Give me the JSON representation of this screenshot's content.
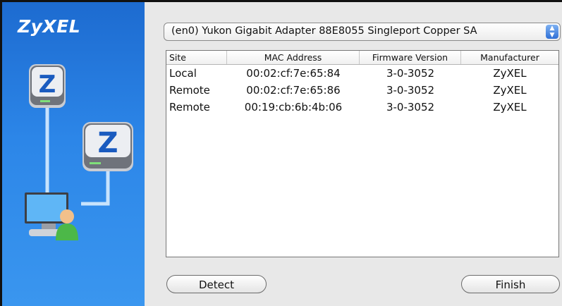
{
  "sidebar": {
    "brand": "ZyXEL",
    "illustration": [
      "router-z-icon",
      "router-z-icon",
      "computer-user-icon"
    ]
  },
  "adapter": {
    "selected": "(en0) Yukon Gigabit Adapter 88E8055 Singleport Copper SA",
    "arrows_up": "▲",
    "arrows_down": "▼"
  },
  "table": {
    "columns": [
      "Site",
      "MAC Address",
      "Firmware Version",
      "Manufacturer"
    ],
    "rows": [
      [
        "Local",
        "00:02:cf:7e:65:84",
        "3-0-3052",
        "ZyXEL"
      ],
      [
        "Remote",
        "00:02:cf:7e:65:86",
        "3-0-3052",
        "ZyXEL"
      ],
      [
        "Remote",
        "00:19:cb:6b:4b:06",
        "3-0-3052",
        "ZyXEL"
      ]
    ]
  },
  "buttons": {
    "detect": "Detect",
    "finish": "Finish"
  },
  "colors": {
    "sidebar_blue": "#2c86e8",
    "select_arrow_blue": "#2f6fd6"
  }
}
